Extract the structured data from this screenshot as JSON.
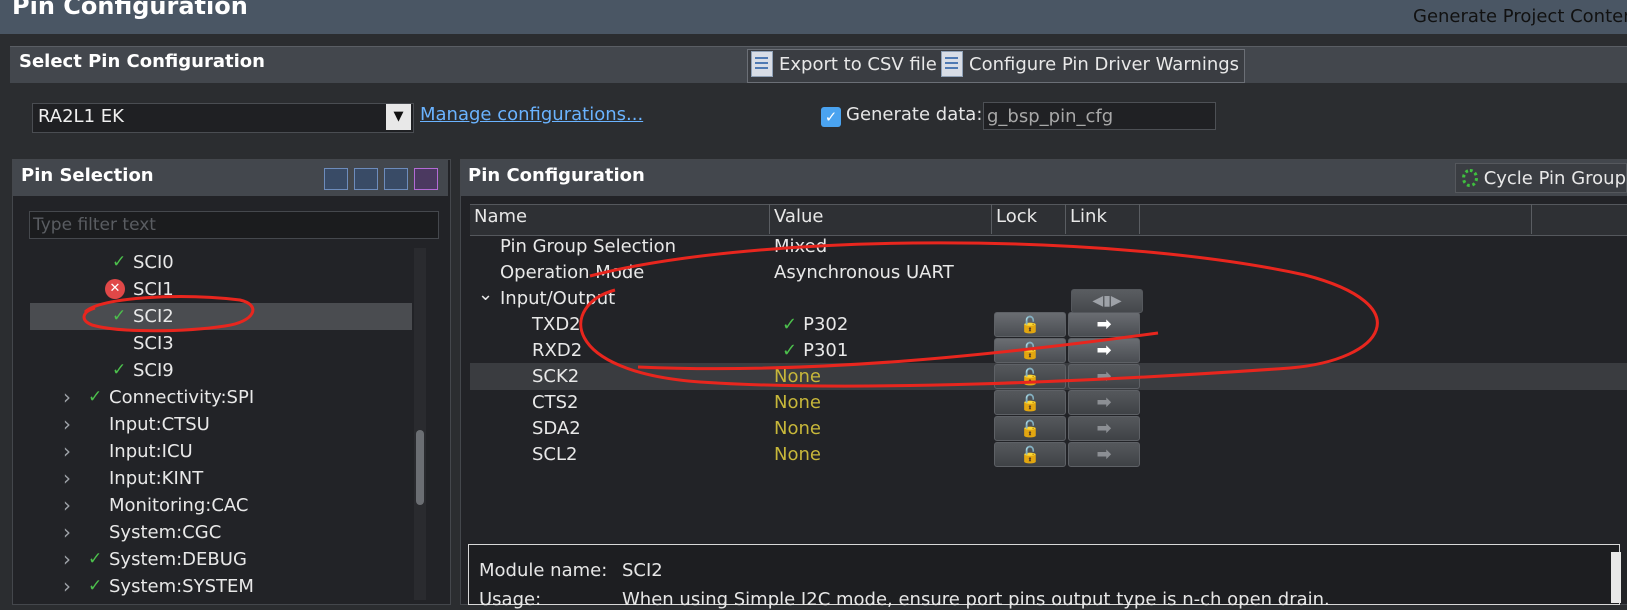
{
  "window": {
    "title": "Pin Configuration",
    "generate_project_content": "Generate Project Content"
  },
  "select_section": {
    "title": "Select Pin Configuration",
    "export_csv": "Export to CSV file",
    "configure_warnings": "Configure Pin Driver Warnings",
    "configuration_value": "RA2L1 EK",
    "manage_link": "Manage configurations...",
    "generate_data_checked": true,
    "generate_data_label": "Generate data:",
    "generate_data_value": "g_bsp_pin_cfg"
  },
  "pin_selection": {
    "title": "Pin Selection",
    "filter_placeholder": "Type filter text",
    "tree": [
      {
        "label": "SCI0",
        "status": "ok",
        "expandable": false,
        "level": 2
      },
      {
        "label": "SCI1",
        "status": "error",
        "expandable": false,
        "level": 2
      },
      {
        "label": "SCI2",
        "status": "ok",
        "expandable": false,
        "level": 2,
        "selected": true
      },
      {
        "label": "SCI3",
        "status": "none",
        "expandable": false,
        "level": 2
      },
      {
        "label": "SCI9",
        "status": "ok",
        "expandable": false,
        "level": 2
      },
      {
        "label": "Connectivity:SPI",
        "status": "ok",
        "expandable": true,
        "level": 1
      },
      {
        "label": "Input:CTSU",
        "status": "none",
        "expandable": true,
        "level": 1
      },
      {
        "label": "Input:ICU",
        "status": "none",
        "expandable": true,
        "level": 1
      },
      {
        "label": "Input:KINT",
        "status": "none",
        "expandable": true,
        "level": 1
      },
      {
        "label": "Monitoring:CAC",
        "status": "none",
        "expandable": true,
        "level": 1
      },
      {
        "label": "System:CGC",
        "status": "none",
        "expandable": true,
        "level": 1
      },
      {
        "label": "System:DEBUG",
        "status": "ok",
        "expandable": true,
        "level": 1
      },
      {
        "label": "System:SYSTEM",
        "status": "ok",
        "expandable": true,
        "level": 1
      }
    ]
  },
  "pin_configuration": {
    "title": "Pin Configuration",
    "cycle_button": "Cycle Pin Group",
    "columns": [
      "Name",
      "Value",
      "Lock",
      "Link"
    ],
    "rows": [
      {
        "name": "Pin Group Selection",
        "value": "Mixed",
        "indent": 1
      },
      {
        "name": "Operation Mode",
        "value": "Asynchronous UART",
        "indent": 1
      },
      {
        "name": "Input/Output",
        "value": "",
        "indent": 1,
        "expandable": true
      },
      {
        "name": "TXD2",
        "value": "P302",
        "indent": 2,
        "ok": true,
        "lock": "active",
        "link": "active"
      },
      {
        "name": "RXD2",
        "value": "P301",
        "indent": 2,
        "ok": true,
        "lock": "active",
        "link": "active"
      },
      {
        "name": "SCK2",
        "value": "None",
        "indent": 2,
        "none": true,
        "lock": "dim",
        "link": "dim",
        "highlighted": true
      },
      {
        "name": "CTS2",
        "value": "None",
        "indent": 2,
        "none": true,
        "lock": "dim",
        "link": "dim"
      },
      {
        "name": "SDA2",
        "value": "None",
        "indent": 2,
        "none": true,
        "lock": "dim",
        "link": "dim"
      },
      {
        "name": "SCL2",
        "value": "None",
        "indent": 2,
        "none": true,
        "lock": "dim",
        "link": "dim"
      }
    ]
  },
  "info": {
    "module_label": "Module name:",
    "module_value": "SCI2",
    "usage_label": "Usage:",
    "usage_value": "When using Simple I2C mode, ensure port pins output type is n-ch open drain."
  }
}
